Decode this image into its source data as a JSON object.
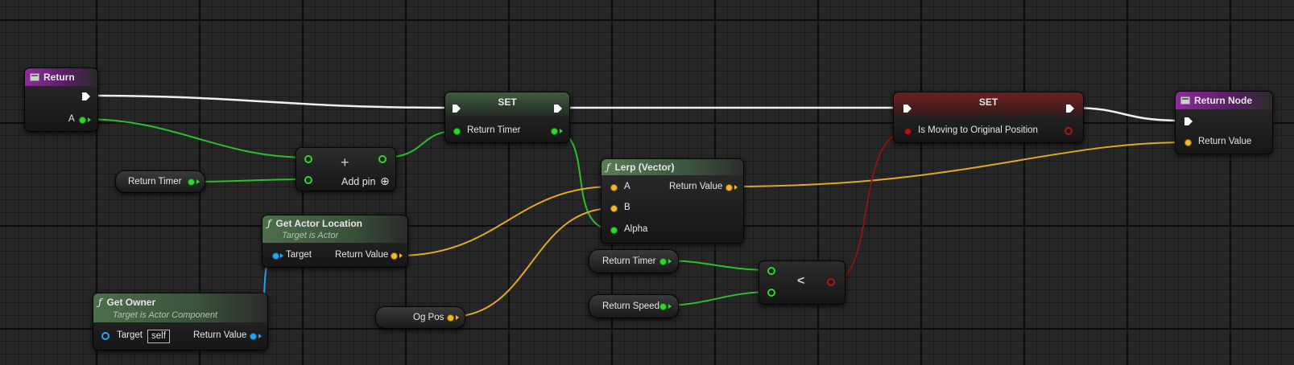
{
  "nodes": {
    "return_event": {
      "title": "Return",
      "pin_a": "A"
    },
    "return_timer_get1": {
      "label": "Return Timer"
    },
    "add_node": {
      "symbol": "+",
      "add_pin": "Add pin",
      "add_pin_icon": "⊕"
    },
    "set_timer": {
      "title": "SET",
      "pin_label": "Return Timer"
    },
    "get_actor_location": {
      "title": "Get Actor Location",
      "subtitle": "Target is Actor",
      "target": "Target",
      "return_value": "Return Value"
    },
    "get_owner": {
      "title": "Get Owner",
      "subtitle": "Target is Actor Component",
      "target": "Target",
      "self_value": "self",
      "return_value": "Return Value"
    },
    "og_pos": {
      "label": "Og Pos"
    },
    "lerp": {
      "title": "Lerp (Vector)",
      "pin_a": "A",
      "pin_b": "B",
      "pin_alpha": "Alpha",
      "return_value": "Return Value"
    },
    "return_timer_get2": {
      "label": "Return Timer"
    },
    "return_speed": {
      "label": "Return Speed"
    },
    "less_than": {
      "symbol": "<"
    },
    "set_moving": {
      "title": "SET",
      "pin_label": "Is Moving to Original Position"
    },
    "return_node": {
      "title": "Return Node",
      "return_value": "Return Value"
    }
  },
  "icons": {
    "function": "function-icon",
    "event": "event-icon"
  },
  "colors": {
    "exec": "#ffffff",
    "float": "#2bd92b",
    "vector": "#f1b82a",
    "object": "#27a5f0",
    "bool": "#b31313"
  }
}
